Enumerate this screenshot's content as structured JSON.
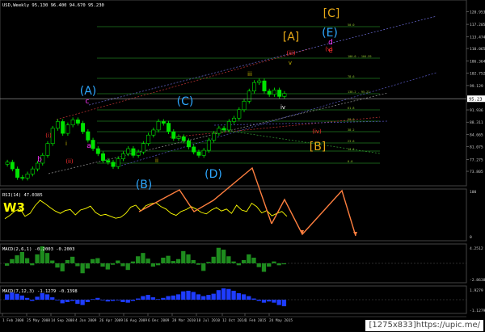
{
  "window": {
    "main_header": "USD,Weekly 95.130 96.400 94.670 95.230",
    "rsi_header": "RSI(14) 47.0385",
    "macd1_header": "MACD(2,6,1) -0.2003 -0.2003",
    "macd2_header": "MACD(7,12,3) -1.1279 -0.1398",
    "w3_label": "W3",
    "watermark": "[1275x833]https://upic.me/"
  },
  "colors": {
    "background": "#000000",
    "price_candles": "#00e400",
    "rsi_line": "#ffff00",
    "macd1_hist": "#1e8c1e",
    "macd2_hist": "#1e3cff",
    "arrow_projection": "#ff7f3f",
    "label_cyan": "#2ea8ff",
    "label_magenta": "#ff33ff",
    "label_orange": "#e6a817",
    "label_red": "#ff3030",
    "label_olive": "#c9b900",
    "grid_green": "#1f7a1f"
  },
  "chart_data": [
    {
      "type": "candlestick",
      "title": "USD,Weekly",
      "ohlc_last": {
        "open": 95.13,
        "high": 96.4,
        "low": 94.67,
        "close": 95.23
      },
      "y_ticks": [
        120.953,
        117.205,
        113.474,
        110.065,
        106.364,
        102.752,
        99.129,
        95.23,
        91.936,
        88.311,
        84.665,
        81.075,
        77.275,
        73.805
      ],
      "current_price": 95.23,
      "x_ticks": [
        "1 Feb 2008",
        "25 May 2008",
        "14 Sep 2008",
        "4 Jan 2009",
        "26 Apr 2009",
        "16 Aug 2009",
        "6 Dec 2009",
        "28 Mar 2010",
        "18 Jul 2010",
        "12 Oct 2014",
        "1 Feb 2015",
        "24 May 2015"
      ],
      "approx_close_series": [
        76.5,
        74.5,
        72.0,
        71.8,
        73.0,
        74.5,
        76.2,
        78.5,
        82.0,
        86.5,
        88.5,
        85.0,
        87.5,
        89.0,
        88.0,
        85.5,
        83.0,
        80.5,
        79.0,
        77.0,
        76.5,
        75.2,
        77.5,
        79.0,
        80.5,
        78.5,
        79.5,
        82.0,
        84.5,
        86.0,
        88.5,
        88.0,
        85.5,
        83.5,
        84.0,
        82.8,
        81.0,
        79.5,
        78.5,
        80.0,
        83.0,
        85.0,
        86.5,
        86.0,
        88.5,
        89.5,
        92.0,
        94.5,
        97.5,
        100.0,
        100.5,
        97.5,
        96.5,
        97.8,
        95.9,
        96.8
      ],
      "wave_labels": [
        "(A)",
        "(B)",
        "(C)",
        "(D)",
        "(E)",
        "[A]",
        "[B]",
        "[C]",
        "a",
        "b",
        "c",
        "d",
        "e",
        "i",
        "ii",
        "iii",
        "iv",
        "v",
        "(i)",
        "(ii)",
        "(iii)",
        "(iv)",
        "(v)"
      ],
      "fib_levels_right": [
        "50.0",
        "100.0 - 104.59",
        "78.6",
        "138.2 - 95.22",
        "61.8",
        "50.0",
        "38.2",
        "23.6",
        "14.6",
        "0.0"
      ]
    },
    {
      "type": "line",
      "title": "RSI(14) 47.0385",
      "ylim": [
        0,
        100
      ],
      "y_ticks": [
        100,
        0
      ],
      "values": [
        42,
        49,
        58,
        63,
        47,
        53,
        69,
        80,
        73,
        65,
        58,
        53,
        59,
        61,
        50,
        60,
        63,
        68,
        55,
        49,
        51,
        47,
        43,
        45,
        53,
        66,
        70,
        58,
        69,
        73,
        75,
        67,
        62,
        53,
        49,
        57,
        61,
        67,
        62,
        55,
        52,
        60,
        65,
        58,
        62,
        53,
        70,
        60,
        57,
        74,
        67,
        54,
        59,
        48,
        53,
        57,
        47
      ]
    },
    {
      "type": "bar",
      "title": "MACD(2,6,1) -0.2003 -0.2003",
      "y_ticks": [
        4.2512,
        -2.8638
      ],
      "values": [
        -0.5,
        0.9,
        1.7,
        2.4,
        1.1,
        -0.4,
        1.9,
        3.6,
        2.2,
        0.6,
        -0.9,
        -1.7,
        0.7,
        1.4,
        -0.6,
        -2.1,
        -1.1,
        0.9,
        1.1,
        -0.7,
        -1.3,
        -0.3,
        0.6,
        -0.6,
        -1.4,
        0.4,
        1.5,
        2.2,
        1.0,
        -0.7,
        -0.4,
        1.2,
        1.6,
        0.5,
        0.9,
        2.6,
        1.9,
        0.7,
        -0.3,
        -1.6,
        0.3,
        1.4,
        3.3,
        2.9,
        1.5,
        0.4,
        -0.4,
        0.7,
        1.9,
        1.2,
        -0.8,
        -1.8,
        -0.7,
        0.4,
        -0.4,
        -0.2
      ]
    },
    {
      "type": "bar",
      "title": "MACD(7,12,3) -1.1279 -0.1398",
      "y_ticks": [
        1.9279,
        -1.1279
      ],
      "values": [
        0.9,
        1.2,
        1.0,
        0.7,
        0.3,
        -0.2,
        0.5,
        1.1,
        0.9,
        0.4,
        -0.1,
        -0.6,
        -0.4,
        -0.2,
        -0.7,
        -0.9,
        -0.4,
        0.1,
        0.3,
        -0.1,
        -0.3,
        -0.2,
        -0.1,
        -0.4,
        -0.5,
        -0.2,
        0.2,
        0.6,
        0.8,
        0.4,
        0.1,
        0.3,
        0.6,
        0.7,
        0.9,
        1.4,
        1.5,
        1.3,
        0.9,
        0.6,
        0.8,
        1.0,
        1.6,
        1.9,
        1.8,
        1.5,
        1.1,
        0.9,
        0.6,
        0.2,
        -0.2,
        -0.5,
        -0.3,
        -0.5,
        -0.9,
        -1.1
      ]
    }
  ]
}
